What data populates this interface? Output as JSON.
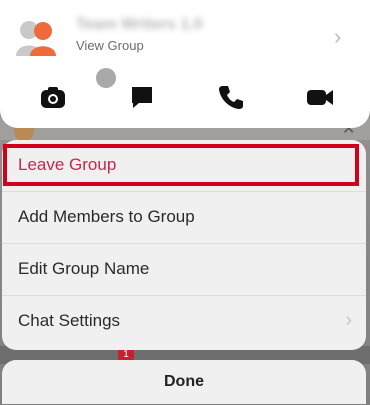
{
  "header": {
    "group_name": "Team Writers 1.0",
    "sub_label": "View Group",
    "actions": [
      {
        "name": "camera-icon"
      },
      {
        "name": "chat-icon"
      },
      {
        "name": "call-icon"
      },
      {
        "name": "video-icon"
      }
    ]
  },
  "background": {
    "badge_count": "1"
  },
  "sheet": {
    "items": [
      {
        "label": "Leave Group",
        "color": "#c6284a",
        "highlighted": true
      },
      {
        "label": "Add Members to Group"
      },
      {
        "label": "Edit Group Name"
      },
      {
        "label": "Chat Settings",
        "chevron": true
      }
    ]
  },
  "done": {
    "label": "Done"
  },
  "colors": {
    "highlight_border": "#d0021b",
    "destructive_text": "#c6284a"
  }
}
